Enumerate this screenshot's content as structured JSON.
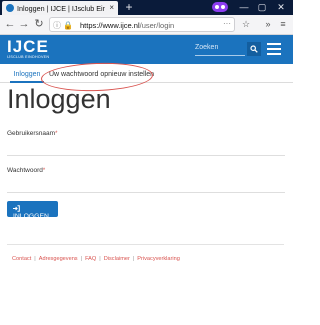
{
  "browser": {
    "tab_title": "Inloggen | IJCE | IJsclub Eindho",
    "tab_close": "×",
    "new_tab": "+",
    "url_host": "https://www.ijce.nl",
    "url_path": "/user/login",
    "url_more": "···",
    "window_controls": [
      "—",
      "▢",
      "✕"
    ]
  },
  "header": {
    "logo_mark": "IJCE",
    "logo_sub": "IJSCLUB EINDHOVEN",
    "search_placeholder": "Zoeken"
  },
  "tabs": {
    "login": "Inloggen",
    "reset": "Uw wachtwoord opnieuw instellen"
  },
  "page_title": "Inloggen",
  "form": {
    "username_label": "Gebruikersnaam",
    "password_label": "Wachtwoord",
    "required_mark": "*",
    "submit_label": "INLOGGEN"
  },
  "footer": {
    "links": [
      "Contact",
      "Adresgegevens",
      "FAQ",
      "Disclaimer",
      "Privacyverklaring"
    ],
    "separator": "|"
  },
  "colors": {
    "brand_blue": "#1b73be",
    "required_red": "#d9534f",
    "annotation_red": "#d9534f"
  }
}
